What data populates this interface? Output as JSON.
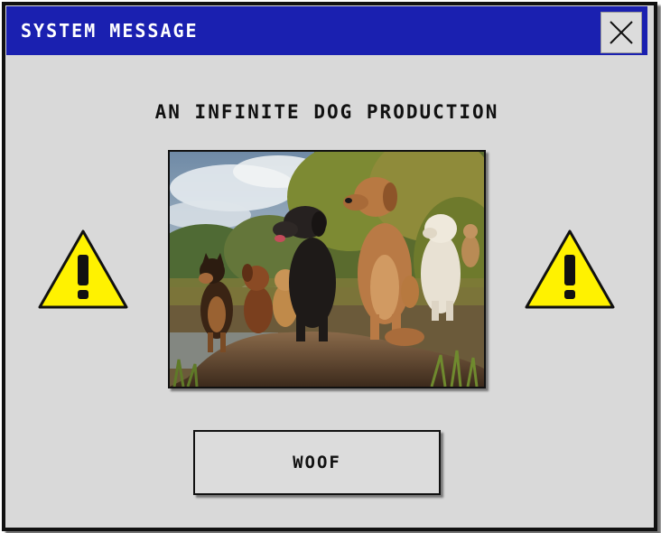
{
  "window": {
    "title": "SYSTEM MESSAGE",
    "close_icon": "close-icon"
  },
  "dialog": {
    "heading": "AN INFINITE DOG PRODUCTION",
    "image": "dogs-photo",
    "left_icon": "warning-icon",
    "right_icon": "warning-icon",
    "button_label": "WOOF"
  },
  "colors": {
    "titlebar": "#1a20b0",
    "window_bg": "#d9d9d9",
    "warning_yellow": "#fff200",
    "border": "#111111"
  }
}
